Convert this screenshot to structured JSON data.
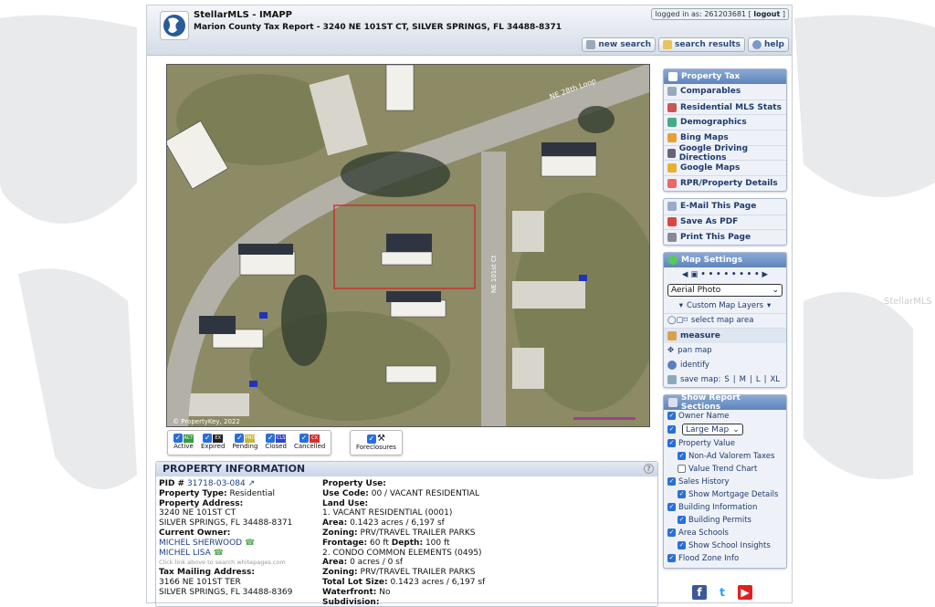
{
  "header": {
    "title": "StellarMLS - IMAPP",
    "subtitle": "Marion County Tax Report - 3240 NE 101ST CT, SILVER SPRINGS, FL 34488-8371",
    "login_text": "logged in as: 261203681 [",
    "logout": "logout",
    "login_close": "]",
    "buttons": [
      {
        "label": "new search",
        "icon": "magnifier-icon"
      },
      {
        "label": "search results",
        "icon": "folder-icon"
      },
      {
        "label": "help",
        "icon": "help-icon"
      }
    ]
  },
  "map": {
    "streets": [
      "NE 28th Loop",
      "NE 101st Ct"
    ],
    "copyright": "© PropertyKey, 2022",
    "markers": [
      "CLS",
      "CLS",
      "CLS"
    ]
  },
  "legend": [
    {
      "label": "Active",
      "flag": "ACT",
      "color": "#3a9a3a"
    },
    {
      "label": "Expired",
      "flag": "EX",
      "color": "#222222"
    },
    {
      "label": "Pending",
      "flag": "PND",
      "color": "#c9b53a"
    },
    {
      "label": "Closed",
      "flag": "CLS",
      "color": "#3346c4"
    },
    {
      "label": "Cancelled",
      "flag": "CX",
      "color": "#d43030"
    }
  ],
  "foreclosures": {
    "label": "Foreclosures"
  },
  "property_info": {
    "heading": "PROPERTY INFORMATION",
    "pid_label": "PID #",
    "pid": "31718-03-084",
    "type_label": "Property Type:",
    "type": "Residential",
    "address_label": "Property Address:",
    "address1": "3240 NE 101ST CT",
    "address2": "SILVER SPRINGS, FL 34488-8371",
    "owner_label": "Current Owner:",
    "owners": [
      "MICHEL SHERWOOD",
      "MICHEL LISA"
    ],
    "owner_hint": "Click link above to search whitepages.com",
    "mail_label": "Tax Mailing Address:",
    "mail1": "3166 NE 101ST TER",
    "mail2": "SILVER SPRINGS, FL 34488-8369",
    "use_label": "Property Use:",
    "use_code_label": "Use Code:",
    "use_code": "00 / VACANT RESIDENTIAL",
    "land_use_label": "Land Use:",
    "land1": "1. VACANT RESIDENTIAL (0001)",
    "area_label": "Area:",
    "area1": "0.1423 acres / 6,197 sf",
    "zoning_label": "Zoning:",
    "zoning1": "PRV/TRAVEL TRAILER PARKS",
    "frontage_label": "Frontage:",
    "frontage": "60 ft",
    "depth_label": "Depth:",
    "depth": "100 ft",
    "land2": "2. CONDO COMMON ELEMENTS (0495)",
    "area2": "0 acres / 0 sf",
    "zoning2": "PRV/TRAVEL TRAILER PARKS",
    "lot_label": "Total Lot Size:",
    "lot": "0.1423 acres / 6,197 sf",
    "water_label": "Waterfront:",
    "water": "No",
    "subdiv_label": "Subdivision:"
  },
  "sidebar": {
    "reports": [
      {
        "label": "Property Tax",
        "icon": "tax-icon"
      },
      {
        "label": "Comparables",
        "icon": "comparables-icon"
      },
      {
        "label": "Residential MLS Stats",
        "icon": "bar-chart-icon"
      },
      {
        "label": "Demographics",
        "icon": "pie-chart-icon"
      },
      {
        "label": "Bing Maps",
        "icon": "bing-icon"
      },
      {
        "label": "Google Driving Directions",
        "icon": "car-icon"
      },
      {
        "label": "Google Maps",
        "icon": "google-maps-icon"
      },
      {
        "label": "RPR/Property Details",
        "icon": "rpr-icon"
      }
    ],
    "actions": [
      {
        "label": "E-Mail This Page",
        "icon": "email-icon"
      },
      {
        "label": "Save As PDF",
        "icon": "pdf-icon"
      },
      {
        "label": "Print This Page",
        "icon": "printer-icon"
      }
    ],
    "map_settings": {
      "heading": "Map Settings",
      "map_type": "Aerial Photo",
      "custom_layers": "Custom Map Layers",
      "select_area": "select map area",
      "measure": "measure",
      "pan": "pan map",
      "identify": "identify",
      "save_map": "save map:",
      "sizes": [
        "S",
        "M",
        "L",
        "XL"
      ]
    },
    "report_sections": {
      "heading": "Show Report Sections",
      "items": [
        {
          "label": "Owner Name",
          "checked": true,
          "sub": false
        },
        {
          "label": "Large Map",
          "checked": true,
          "sub": false,
          "select": true
        },
        {
          "label": "Property Value",
          "checked": true,
          "sub": false
        },
        {
          "label": "Non-Ad Valorem Taxes",
          "checked": true,
          "sub": true
        },
        {
          "label": "Value Trend Chart",
          "checked": false,
          "sub": true
        },
        {
          "label": "Sales History",
          "checked": true,
          "sub": false
        },
        {
          "label": "Show Mortgage Details",
          "checked": true,
          "sub": true
        },
        {
          "label": "Building Information",
          "checked": true,
          "sub": false
        },
        {
          "label": "Building Permits",
          "checked": true,
          "sub": true
        },
        {
          "label": "Area Schools",
          "checked": true,
          "sub": false
        },
        {
          "label": "Show School Insights",
          "checked": true,
          "sub": true
        },
        {
          "label": "Flood Zone Info",
          "checked": true,
          "sub": false
        }
      ]
    }
  },
  "social": [
    {
      "name": "facebook-icon",
      "glyph": "f",
      "color": "#3b5998"
    },
    {
      "name": "twitter-icon",
      "glyph": "t",
      "color": "#1da1f2"
    },
    {
      "name": "youtube-icon",
      "glyph": "▶",
      "color": "#e02020"
    }
  ],
  "watermark": "StellarMLS"
}
